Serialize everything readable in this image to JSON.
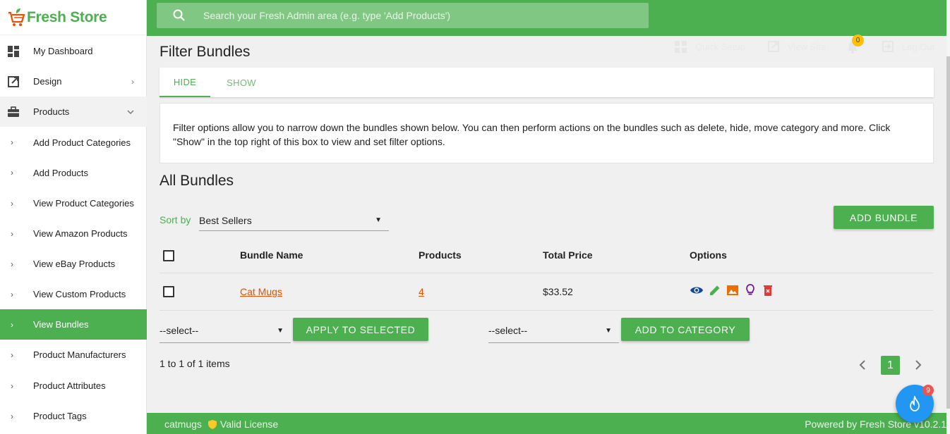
{
  "app": {
    "logo_text": "Fresh Store"
  },
  "colors": {
    "brand": "#4caf50",
    "link": "#e65100",
    "fab": "#2196f3"
  },
  "search": {
    "placeholder": "Search your Fresh Admin area (e.g. type 'Add Products')"
  },
  "topbar": {
    "quick_setup": "Quick Setup",
    "view_site": "View Site",
    "notifications_count": "0",
    "log_out": "Log Out"
  },
  "sidebar": {
    "my_dashboard": "My Dashboard",
    "design": "Design",
    "products": "Products",
    "sub_items": [
      "Add Product Categories",
      "Add Products",
      "View Product Categories",
      "View Amazon Products",
      "View eBay Products",
      "View Custom Products",
      "View Bundles",
      "Product Manufacturers",
      "Product Attributes",
      "Product Tags"
    ]
  },
  "filter": {
    "title": "Filter Bundles",
    "tab_hide": "HIDE",
    "tab_show": "SHOW",
    "info_text": "Filter options allow you to narrow down the bundles shown below. You can then perform actions on the bundles such as delete, hide, move category and more. Click \"Show\" in the top right of this box to view and set filter options."
  },
  "bundles": {
    "title": "All Bundles",
    "sort_label": "Sort by",
    "sort_value": "Best Sellers",
    "add_bundle": "ADD BUNDLE",
    "columns": {
      "name": "Bundle Name",
      "products": "Products",
      "total_price": "Total Price",
      "options": "Options"
    },
    "rows": [
      {
        "name": "Cat Mugs",
        "products": "4",
        "total_price": "$33.52"
      }
    ],
    "option_icons": [
      "eye-icon",
      "pencil-icon",
      "image-icon",
      "lightbulb-icon",
      "delete-icon"
    ],
    "bulk_select_value": "--select--",
    "apply_selected": "APPLY TO SELECTED",
    "category_select_value": "--select--",
    "add_to_category": "ADD TO CATEGORY",
    "pagination_info": "1 to 1 of 1 items",
    "current_page": "1"
  },
  "footer": {
    "store_name": "catmugs",
    "license": "Valid License",
    "powered_by": "Powered by Fresh Store v10.2.1"
  },
  "fab": {
    "badge_count": "9"
  }
}
